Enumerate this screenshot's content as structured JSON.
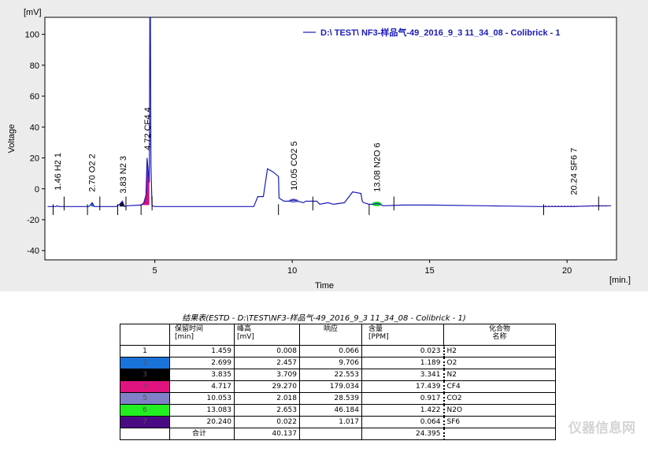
{
  "chart_data": {
    "type": "line",
    "y_unit_label": "[mV]",
    "x_unit_label": "[min.]",
    "ylabel": "Voltage",
    "xlabel": "Time",
    "xlim": [
      1,
      21.8
    ],
    "ylim": [
      -46,
      111
    ],
    "x_ticks": [
      5,
      10,
      15,
      20
    ],
    "y_ticks": [
      -40,
      -20,
      0,
      20,
      40,
      60,
      80,
      100
    ],
    "grid": false,
    "legend_position": "top-right",
    "series": [
      {
        "name": "D:\\ TEST\\ NF3-样品气-49_2016_9_3 11_34_08 - Colibrick - 1",
        "color": "#1a1ab8",
        "x": [
          1.1,
          1.4,
          1.45,
          1.5,
          2.6,
          2.68,
          2.72,
          2.8,
          3.6,
          3.72,
          3.82,
          3.9,
          4.0,
          4.5,
          4.6,
          4.68,
          4.72,
          4.76,
          4.8,
          4.82,
          4.84,
          4.86,
          4.9,
          5.0,
          8.0,
          8.6,
          8.75,
          8.95,
          9.1,
          9.3,
          9.5,
          9.52,
          9.7,
          9.9,
          10.05,
          10.2,
          10.4,
          10.5,
          10.9,
          11.0,
          11.3,
          11.5,
          11.9,
          12.2,
          12.5,
          12.55,
          12.6,
          12.8,
          12.95,
          13.08,
          13.2,
          13.3,
          14.0,
          15.0,
          17.0,
          19.0,
          20.24,
          21.0,
          21.6
        ],
        "y": [
          -11.5,
          -11.5,
          -11,
          -11.5,
          -11.5,
          -10,
          -9,
          -11.5,
          -11.5,
          -10,
          -8,
          -11.5,
          -11,
          -10.5,
          -9,
          -4,
          20,
          12,
          4,
          111,
          111,
          15,
          -11,
          -11.5,
          -11.5,
          -11.5,
          -5,
          -5,
          13,
          11,
          8,
          -6,
          -8,
          -8,
          -7,
          -8,
          -9,
          -8,
          -8,
          -10,
          -9,
          -10,
          -9,
          -2,
          -3,
          -8,
          -9,
          -10,
          -10,
          -9.5,
          -10,
          -11,
          -10.5,
          -10.5,
          -11,
          -11.5,
          -11.5,
          -11,
          -11
        ]
      }
    ],
    "peaks": [
      {
        "label": "1.46 H2  1",
        "x": 1.46,
        "y_label_start": -1,
        "color": null
      },
      {
        "label": "2.70 O2  2",
        "x": 2.7,
        "y_label_start": -2,
        "color": "#1a73d9"
      },
      {
        "label": "3.83 N2  3",
        "x": 3.83,
        "y_label_start": -3,
        "color": "#111111"
      },
      {
        "label": "4.72 CF4  4",
        "x": 4.72,
        "y_label_start": 25,
        "color": "#d40f7a"
      },
      {
        "label": "10.05 CO2  5",
        "x": 10.05,
        "y_label_start": -1,
        "color": "#8080c8"
      },
      {
        "label": "13.08 N2O  6",
        "x": 13.08,
        "y_label_start": -2,
        "color": "#22e022"
      },
      {
        "label": "20.24 SF6  7",
        "x": 20.24,
        "y_label_start": -4,
        "color": "#4a0a84"
      }
    ]
  },
  "results": {
    "title": "结果表(ESTD - D:\\TEST\\NF3-样品气-49_2016_9_3 11_34_08 - Colibrick - 1)",
    "headers": [
      "",
      "保留时间 [min]",
      "峰高 [mV]",
      "响应",
      "含量 [PPM]",
      "化合物 名称"
    ],
    "rows": [
      {
        "idx": "1",
        "color": "#ffffff",
        "rt": "1.459",
        "height": "0.008",
        "response": "0.066",
        "content": "0.023",
        "name": "H2"
      },
      {
        "idx": "2",
        "color": "#1a73d9",
        "rt": "2.699",
        "height": "2.457",
        "response": "9.706",
        "content": "1.189",
        "name": "O2"
      },
      {
        "idx": "3",
        "color": "#000000",
        "rt": "3.835",
        "height": "3.709",
        "response": "22.553",
        "content": "3.341",
        "name": "N2"
      },
      {
        "idx": "4",
        "color": "#e0137f",
        "rt": "4.717",
        "height": "29.270",
        "response": "179.034",
        "content": "17.439",
        "name": "CF4"
      },
      {
        "idx": "5",
        "color": "#8080c8",
        "rt": "10.053",
        "height": "2.018",
        "response": "28.539",
        "content": "0.917",
        "name": "CO2"
      },
      {
        "idx": "6",
        "color": "#22ee22",
        "rt": "13.083",
        "height": "2.653",
        "response": "46.184",
        "content": "1.422",
        "name": "N2O"
      },
      {
        "idx": "7",
        "color": "#4a0a84",
        "rt": "20.240",
        "height": "0.022",
        "response": "1.017",
        "content": "0.064",
        "name": "SF6"
      }
    ],
    "total": {
      "label": "合计",
      "height": "40.137",
      "content": "24.395"
    }
  },
  "watermark": "仪器信息网"
}
